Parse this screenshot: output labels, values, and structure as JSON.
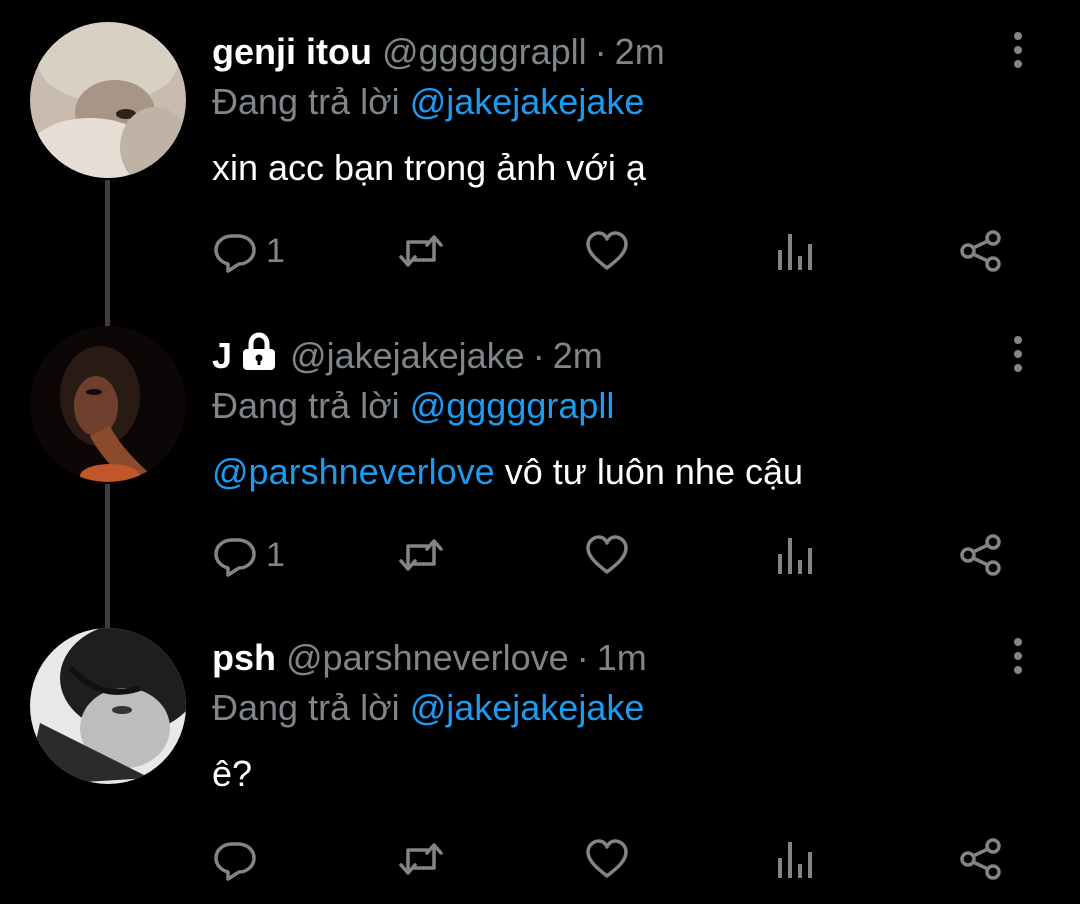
{
  "colors": {
    "background": "#000000",
    "text_primary": "#ffffff",
    "text_secondary": "#808589",
    "link": "#1d9bf0",
    "thread_line": "#3d3d3d"
  },
  "tweets": [
    {
      "display_name": "genji itou",
      "locked": false,
      "handle": "@gggggrapll",
      "separator": "·",
      "time": "2m",
      "reply_prefix": "Đang trả lời",
      "reply_to": "@jakejakejake",
      "mention": "",
      "text": "xin acc bạn trong ảnh với ạ",
      "reply_count": "1"
    },
    {
      "display_name": "J",
      "locked": true,
      "handle": "@jakejakejake",
      "separator": "·",
      "time": "2m",
      "reply_prefix": "Đang trả lời",
      "reply_to": "@gggggrapll",
      "mention": "@parshneverlove",
      "text": " vô tư luôn nhe cậu",
      "reply_count": "1"
    },
    {
      "display_name": "psh",
      "locked": false,
      "handle": "@parshneverlove",
      "separator": "·",
      "time": "1m",
      "reply_prefix": "Đang trả lời",
      "reply_to": "@jakejakejake",
      "mention": "",
      "text": "ê?",
      "reply_count": ""
    }
  ],
  "icons": {
    "reply": "reply-icon",
    "retweet": "retweet-icon",
    "like": "heart-icon",
    "analytics": "analytics-icon",
    "share": "share-icon",
    "more": "more-vertical-icon",
    "lock": "lock-icon"
  }
}
